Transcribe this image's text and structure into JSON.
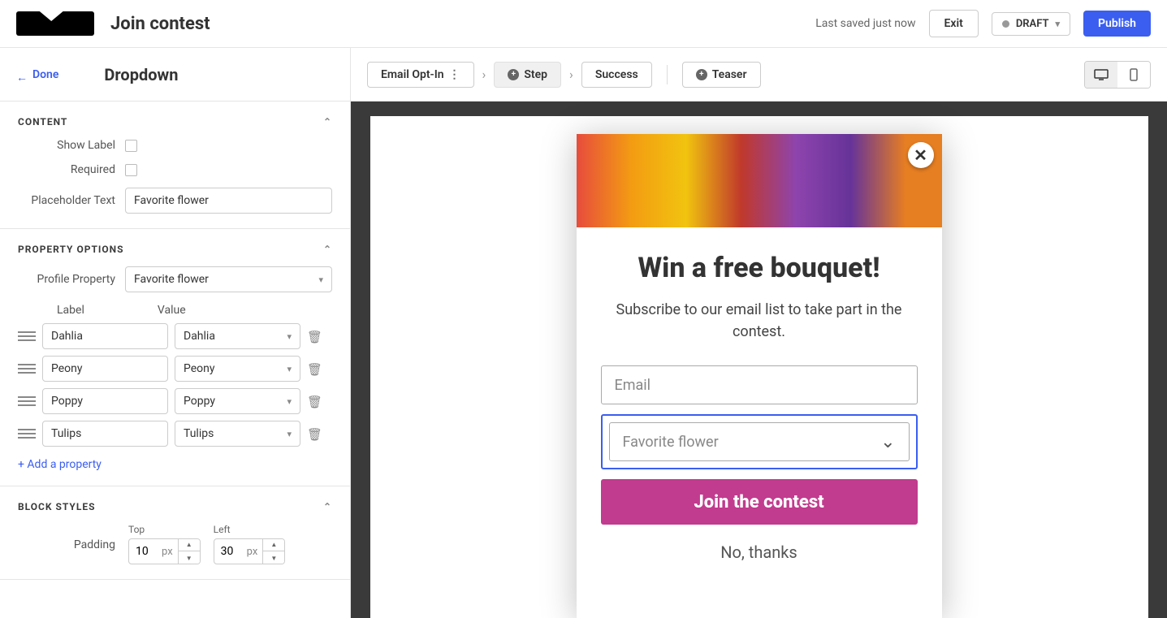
{
  "topbar": {
    "title": "Join contest",
    "last_saved": "Last saved just now",
    "exit": "Exit",
    "status": "DRAFT",
    "publish": "Publish"
  },
  "editor": {
    "done": "Done",
    "block_title": "Dropdown",
    "content": {
      "header": "CONTENT",
      "show_label": "Show Label",
      "required": "Required",
      "placeholder_label": "Placeholder Text",
      "placeholder_value": "Favorite flower"
    },
    "property_options": {
      "header": "PROPERTY OPTIONS",
      "profile_label": "Profile Property",
      "profile_value": "Favorite flower",
      "col_label": "Label",
      "col_value": "Value",
      "options": [
        {
          "label": "Dahlia",
          "value": "Dahlia"
        },
        {
          "label": "Peony",
          "value": "Peony"
        },
        {
          "label": "Poppy",
          "value": "Poppy"
        },
        {
          "label": "Tulips",
          "value": "Tulips"
        }
      ],
      "add": "+ Add a property"
    },
    "block_styles": {
      "header": "BLOCK STYLES",
      "padding_label": "Padding",
      "top_label": "Top",
      "top_value": "10",
      "left_label": "Left",
      "left_value": "30",
      "unit": "px"
    }
  },
  "toolbar": {
    "email_opt_in": "Email Opt-In",
    "step": "Step",
    "success": "Success",
    "teaser": "Teaser"
  },
  "popup": {
    "headline": "Win a free bouquet!",
    "subhead": "Subscribe to our email list to take part in the contest.",
    "email_placeholder": "Email",
    "dropdown_placeholder": "Favorite flower",
    "cta": "Join the contest",
    "dismiss": "No, thanks"
  }
}
